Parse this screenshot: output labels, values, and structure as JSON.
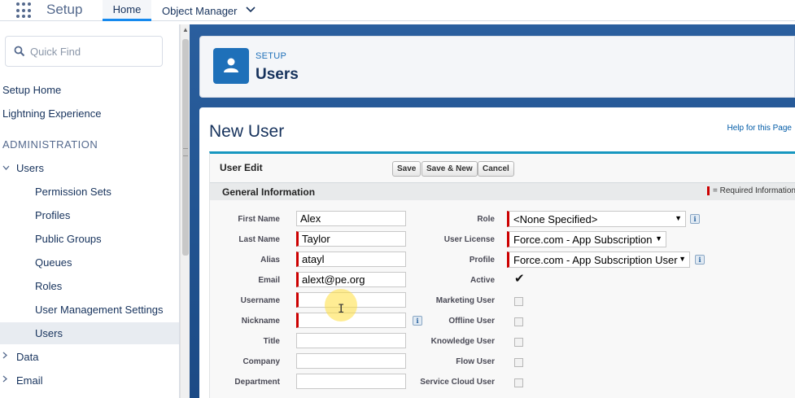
{
  "topbar": {
    "app_title": "Setup",
    "tabs": [
      {
        "label": "Home"
      },
      {
        "label": "Object Manager"
      }
    ]
  },
  "sidebar": {
    "quickfind_placeholder": "Quick Find",
    "items": [
      {
        "label": "Setup Home"
      },
      {
        "label": "Lightning Experience"
      },
      {
        "label": "ADMINISTRATION"
      },
      {
        "label": "Users"
      },
      {
        "label": "Permission Sets"
      },
      {
        "label": "Profiles"
      },
      {
        "label": "Public Groups"
      },
      {
        "label": "Queues"
      },
      {
        "label": "Roles"
      },
      {
        "label": "User Management Settings"
      },
      {
        "label": "Users"
      },
      {
        "label": "Data"
      },
      {
        "label": "Email"
      }
    ],
    "active_item": "Users"
  },
  "header": {
    "eyebrow": "SETUP",
    "title": "Users",
    "icon": "user-icon"
  },
  "page": {
    "title": "New User",
    "help_link": "Help for this Page"
  },
  "form": {
    "section_title": "User Edit",
    "buttons": {
      "save": "Save",
      "save_new": "Save & New",
      "cancel": "Cancel"
    },
    "subsection_title": "General Information",
    "required_legend": "= Required Information",
    "left_fields": [
      {
        "label": "First Name",
        "value": "Alex",
        "required": false
      },
      {
        "label": "Last Name",
        "value": "Taylor",
        "required": true
      },
      {
        "label": "Alias",
        "value": "atayl",
        "required": true
      },
      {
        "label": "Email",
        "value": "alext@pe.org",
        "required": true
      },
      {
        "label": "Username",
        "value": "",
        "required": true
      },
      {
        "label": "Nickname",
        "value": "",
        "required": true
      },
      {
        "label": "Title",
        "value": "",
        "required": false
      },
      {
        "label": "Company",
        "value": "",
        "required": false
      },
      {
        "label": "Department",
        "value": "",
        "required": false
      }
    ],
    "right_fields": {
      "role_label": "Role",
      "role_value": "<None Specified>",
      "license_label": "User License",
      "license_value": "Force.com - App Subscription",
      "profile_label": "Profile",
      "profile_value": "Force.com - App Subscription User",
      "active_label": "Active",
      "marketing_label": "Marketing User",
      "offline_label": "Offline User",
      "knowledge_label": "Knowledge User",
      "flow_label": "Flow User",
      "service_cloud_label": "Service Cloud User"
    },
    "active_checked": true
  },
  "colors": {
    "accent": "#1589ee",
    "brand_blue": "#1e70b9",
    "required_red": "#cc0000",
    "section_border": "#1797c0"
  }
}
